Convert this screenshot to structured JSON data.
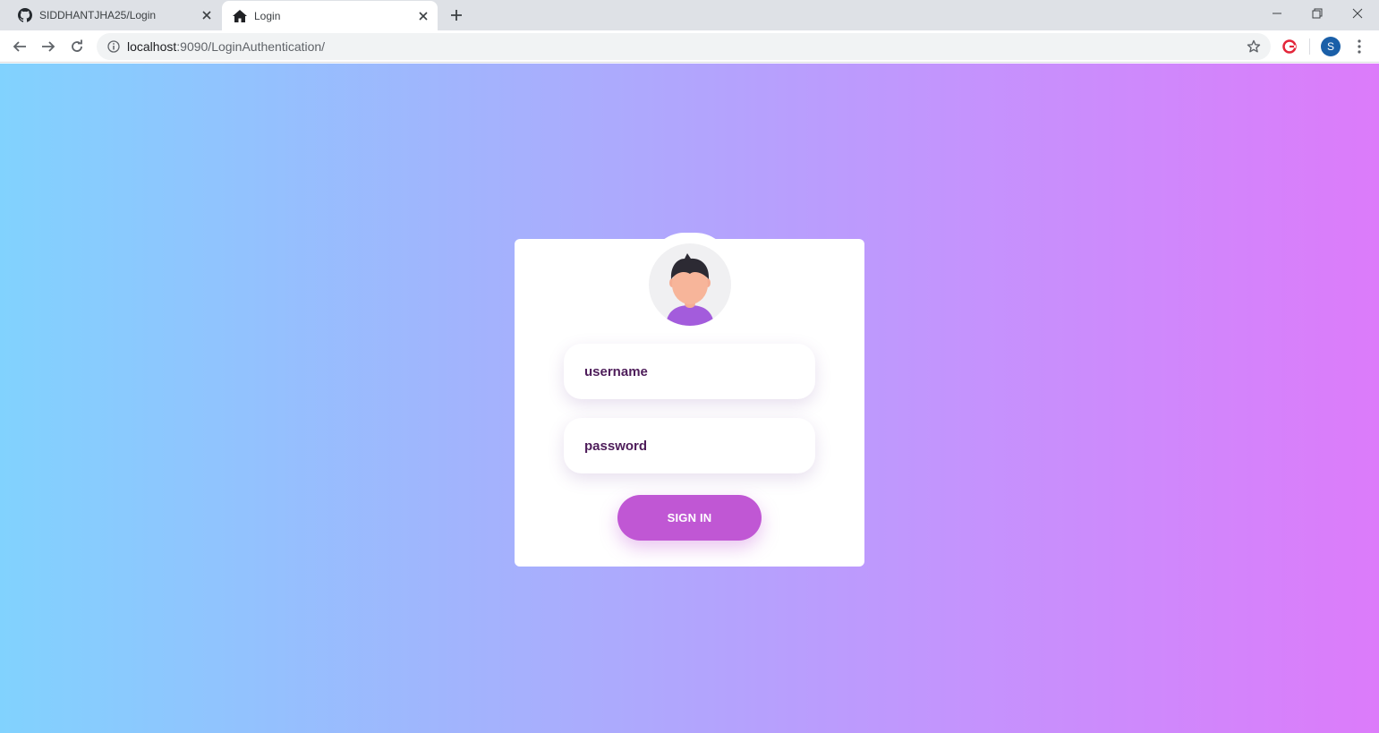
{
  "browser": {
    "tabs": [
      {
        "title": "SIDDHANTJHA25/Login",
        "icon": "github-icon",
        "active": false
      },
      {
        "title": "Login",
        "icon": "home-icon",
        "active": true
      }
    ],
    "url_host": "localhost",
    "url_path": ":9090/LoginAuthentication/",
    "profile_initial": "S"
  },
  "login": {
    "username_placeholder": "username",
    "password_placeholder": "password",
    "signin_label": "SIGN IN"
  },
  "colors": {
    "gradient_start": "#81d2fe",
    "gradient_end": "#dc7bfa",
    "button": "#c057d4",
    "input_text": "#4e1d5a"
  }
}
